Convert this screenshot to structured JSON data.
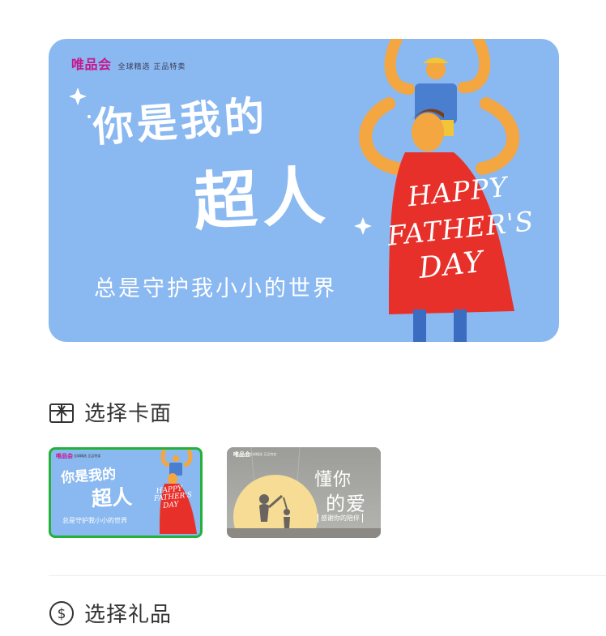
{
  "card_preview": {
    "brand": "唯品会",
    "brand_tagline": "全球精选  正品特卖",
    "title_line1": "你是我的",
    "title_line2": "超人",
    "subtitle": "总是守护我小小的世界",
    "cape_line1": "HAPPY",
    "cape_line2": "FATHER'S",
    "cape_line3": "DAY"
  },
  "section_card": {
    "label": "选择卡面",
    "icon": "gift-box-icon"
  },
  "thumbnails": [
    {
      "brand": "唯品会",
      "tagline": "全球精选  正品特卖",
      "title_line1": "你是我的",
      "title_line2": "超人",
      "subtitle": "总是守护我小小的世界",
      "cape": "HAPPY FATHER'S DAY",
      "selected": true
    },
    {
      "brand": "唯品会",
      "tagline": "全球精选  正品特卖",
      "title_line1": "懂你",
      "title_line2": "的爱",
      "subtitle": "感谢你的陪伴",
      "selected": false
    }
  ],
  "section_gift": {
    "label": "选择礼品",
    "icon": "dollar-coin-icon"
  },
  "colors": {
    "card_bg": "#8ab8f0",
    "cape_red": "#e8302a",
    "selected_border": "#23b13a",
    "brand_magenta": "#c8168c",
    "thumb2_bg": "#a8a8a8",
    "moon": "#f6dc94"
  }
}
